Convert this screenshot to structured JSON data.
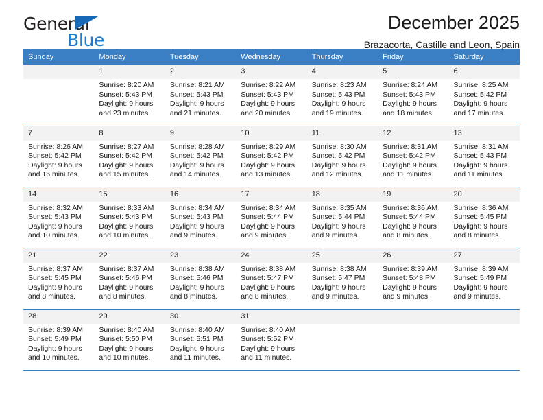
{
  "brand": {
    "word1": "General",
    "word2": "Blue",
    "triangle_color": "#1669b6",
    "word2_color": "#1a7fd4"
  },
  "header": {
    "title": "December 2025",
    "subtitle": "Brazacorta, Castille and Leon, Spain"
  },
  "theme": {
    "header_bg": "#3a7fc4",
    "daynum_bg": "#f2f2f2",
    "grid_line": "#3a7fc4"
  },
  "weekdays": [
    "Sunday",
    "Monday",
    "Tuesday",
    "Wednesday",
    "Thursday",
    "Friday",
    "Saturday"
  ],
  "weeks": [
    [
      {
        "day": "",
        "lines": []
      },
      {
        "day": "1",
        "lines": [
          "Sunrise: 8:20 AM",
          "Sunset: 5:43 PM",
          "Daylight: 9 hours",
          "and 23 minutes."
        ]
      },
      {
        "day": "2",
        "lines": [
          "Sunrise: 8:21 AM",
          "Sunset: 5:43 PM",
          "Daylight: 9 hours",
          "and 21 minutes."
        ]
      },
      {
        "day": "3",
        "lines": [
          "Sunrise: 8:22 AM",
          "Sunset: 5:43 PM",
          "Daylight: 9 hours",
          "and 20 minutes."
        ]
      },
      {
        "day": "4",
        "lines": [
          "Sunrise: 8:23 AM",
          "Sunset: 5:43 PM",
          "Daylight: 9 hours",
          "and 19 minutes."
        ]
      },
      {
        "day": "5",
        "lines": [
          "Sunrise: 8:24 AM",
          "Sunset: 5:43 PM",
          "Daylight: 9 hours",
          "and 18 minutes."
        ]
      },
      {
        "day": "6",
        "lines": [
          "Sunrise: 8:25 AM",
          "Sunset: 5:42 PM",
          "Daylight: 9 hours",
          "and 17 minutes."
        ]
      }
    ],
    [
      {
        "day": "7",
        "lines": [
          "Sunrise: 8:26 AM",
          "Sunset: 5:42 PM",
          "Daylight: 9 hours",
          "and 16 minutes."
        ]
      },
      {
        "day": "8",
        "lines": [
          "Sunrise: 8:27 AM",
          "Sunset: 5:42 PM",
          "Daylight: 9 hours",
          "and 15 minutes."
        ]
      },
      {
        "day": "9",
        "lines": [
          "Sunrise: 8:28 AM",
          "Sunset: 5:42 PM",
          "Daylight: 9 hours",
          "and 14 minutes."
        ]
      },
      {
        "day": "10",
        "lines": [
          "Sunrise: 8:29 AM",
          "Sunset: 5:42 PM",
          "Daylight: 9 hours",
          "and 13 minutes."
        ]
      },
      {
        "day": "11",
        "lines": [
          "Sunrise: 8:30 AM",
          "Sunset: 5:42 PM",
          "Daylight: 9 hours",
          "and 12 minutes."
        ]
      },
      {
        "day": "12",
        "lines": [
          "Sunrise: 8:31 AM",
          "Sunset: 5:42 PM",
          "Daylight: 9 hours",
          "and 11 minutes."
        ]
      },
      {
        "day": "13",
        "lines": [
          "Sunrise: 8:31 AM",
          "Sunset: 5:43 PM",
          "Daylight: 9 hours",
          "and 11 minutes."
        ]
      }
    ],
    [
      {
        "day": "14",
        "lines": [
          "Sunrise: 8:32 AM",
          "Sunset: 5:43 PM",
          "Daylight: 9 hours",
          "and 10 minutes."
        ]
      },
      {
        "day": "15",
        "lines": [
          "Sunrise: 8:33 AM",
          "Sunset: 5:43 PM",
          "Daylight: 9 hours",
          "and 10 minutes."
        ]
      },
      {
        "day": "16",
        "lines": [
          "Sunrise: 8:34 AM",
          "Sunset: 5:43 PM",
          "Daylight: 9 hours",
          "and 9 minutes."
        ]
      },
      {
        "day": "17",
        "lines": [
          "Sunrise: 8:34 AM",
          "Sunset: 5:44 PM",
          "Daylight: 9 hours",
          "and 9 minutes."
        ]
      },
      {
        "day": "18",
        "lines": [
          "Sunrise: 8:35 AM",
          "Sunset: 5:44 PM",
          "Daylight: 9 hours",
          "and 9 minutes."
        ]
      },
      {
        "day": "19",
        "lines": [
          "Sunrise: 8:36 AM",
          "Sunset: 5:44 PM",
          "Daylight: 9 hours",
          "and 8 minutes."
        ]
      },
      {
        "day": "20",
        "lines": [
          "Sunrise: 8:36 AM",
          "Sunset: 5:45 PM",
          "Daylight: 9 hours",
          "and 8 minutes."
        ]
      }
    ],
    [
      {
        "day": "21",
        "lines": [
          "Sunrise: 8:37 AM",
          "Sunset: 5:45 PM",
          "Daylight: 9 hours",
          "and 8 minutes."
        ]
      },
      {
        "day": "22",
        "lines": [
          "Sunrise: 8:37 AM",
          "Sunset: 5:46 PM",
          "Daylight: 9 hours",
          "and 8 minutes."
        ]
      },
      {
        "day": "23",
        "lines": [
          "Sunrise: 8:38 AM",
          "Sunset: 5:46 PM",
          "Daylight: 9 hours",
          "and 8 minutes."
        ]
      },
      {
        "day": "24",
        "lines": [
          "Sunrise: 8:38 AM",
          "Sunset: 5:47 PM",
          "Daylight: 9 hours",
          "and 8 minutes."
        ]
      },
      {
        "day": "25",
        "lines": [
          "Sunrise: 8:38 AM",
          "Sunset: 5:47 PM",
          "Daylight: 9 hours",
          "and 9 minutes."
        ]
      },
      {
        "day": "26",
        "lines": [
          "Sunrise: 8:39 AM",
          "Sunset: 5:48 PM",
          "Daylight: 9 hours",
          "and 9 minutes."
        ]
      },
      {
        "day": "27",
        "lines": [
          "Sunrise: 8:39 AM",
          "Sunset: 5:49 PM",
          "Daylight: 9 hours",
          "and 9 minutes."
        ]
      }
    ],
    [
      {
        "day": "28",
        "lines": [
          "Sunrise: 8:39 AM",
          "Sunset: 5:49 PM",
          "Daylight: 9 hours",
          "and 10 minutes."
        ]
      },
      {
        "day": "29",
        "lines": [
          "Sunrise: 8:40 AM",
          "Sunset: 5:50 PM",
          "Daylight: 9 hours",
          "and 10 minutes."
        ]
      },
      {
        "day": "30",
        "lines": [
          "Sunrise: 8:40 AM",
          "Sunset: 5:51 PM",
          "Daylight: 9 hours",
          "and 11 minutes."
        ]
      },
      {
        "day": "31",
        "lines": [
          "Sunrise: 8:40 AM",
          "Sunset: 5:52 PM",
          "Daylight: 9 hours",
          "and 11 minutes."
        ]
      },
      {
        "day": "",
        "lines": []
      },
      {
        "day": "",
        "lines": []
      },
      {
        "day": "",
        "lines": []
      }
    ]
  ]
}
